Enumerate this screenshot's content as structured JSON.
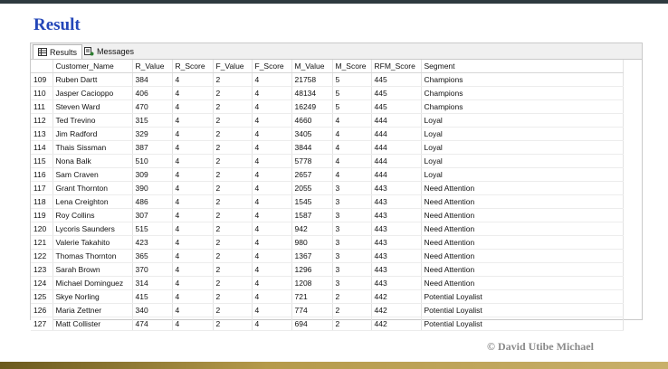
{
  "page": {
    "title": "Result",
    "copyright": "© David Utibe Michael"
  },
  "tabs": [
    {
      "label": "Results",
      "icon": "grid-icon",
      "active": true
    },
    {
      "label": "Messages",
      "icon": "messages-icon",
      "active": false
    }
  ],
  "table": {
    "columns": [
      "Customer_Name",
      "R_Value",
      "R_Score",
      "F_Value",
      "F_Score",
      "M_Value",
      "M_Score",
      "RFM_Score",
      "Segment"
    ],
    "rows": [
      {
        "num": "109",
        "cells": [
          "Ruben Dartt",
          "384",
          "4",
          "2",
          "4",
          "21758",
          "5",
          "445",
          "Champions"
        ]
      },
      {
        "num": "110",
        "cells": [
          "Jasper Cacioppo",
          "406",
          "4",
          "2",
          "4",
          "48134",
          "5",
          "445",
          "Champions"
        ]
      },
      {
        "num": "111",
        "cells": [
          "Steven Ward",
          "470",
          "4",
          "2",
          "4",
          "16249",
          "5",
          "445",
          "Champions"
        ]
      },
      {
        "num": "112",
        "cells": [
          "Ted Trevino",
          "315",
          "4",
          "2",
          "4",
          "4660",
          "4",
          "444",
          "Loyal"
        ]
      },
      {
        "num": "113",
        "cells": [
          "Jim Radford",
          "329",
          "4",
          "2",
          "4",
          "3405",
          "4",
          "444",
          "Loyal"
        ]
      },
      {
        "num": "114",
        "cells": [
          "Thais Sissman",
          "387",
          "4",
          "2",
          "4",
          "3844",
          "4",
          "444",
          "Loyal"
        ]
      },
      {
        "num": "115",
        "cells": [
          "Nona Balk",
          "510",
          "4",
          "2",
          "4",
          "5778",
          "4",
          "444",
          "Loyal"
        ]
      },
      {
        "num": "116",
        "cells": [
          "Sam Craven",
          "309",
          "4",
          "2",
          "4",
          "2657",
          "4",
          "444",
          "Loyal"
        ]
      },
      {
        "num": "117",
        "cells": [
          "Grant Thornton",
          "390",
          "4",
          "2",
          "4",
          "2055",
          "3",
          "443",
          "Need Attention"
        ]
      },
      {
        "num": "118",
        "cells": [
          "Lena Creighton",
          "486",
          "4",
          "2",
          "4",
          "1545",
          "3",
          "443",
          "Need Attention"
        ]
      },
      {
        "num": "119",
        "cells": [
          "Roy Collins",
          "307",
          "4",
          "2",
          "4",
          "1587",
          "3",
          "443",
          "Need Attention"
        ]
      },
      {
        "num": "120",
        "cells": [
          "Lycoris Saunders",
          "515",
          "4",
          "2",
          "4",
          "942",
          "3",
          "443",
          "Need Attention"
        ]
      },
      {
        "num": "121",
        "cells": [
          "Valerie Takahito",
          "423",
          "4",
          "2",
          "4",
          "980",
          "3",
          "443",
          "Need Attention"
        ]
      },
      {
        "num": "122",
        "cells": [
          "Thomas Thornton",
          "365",
          "4",
          "2",
          "4",
          "1367",
          "3",
          "443",
          "Need Attention"
        ]
      },
      {
        "num": "123",
        "cells": [
          "Sarah Brown",
          "370",
          "4",
          "2",
          "4",
          "1296",
          "3",
          "443",
          "Need Attention"
        ]
      },
      {
        "num": "124",
        "cells": [
          "Michael Dominguez",
          "314",
          "4",
          "2",
          "4",
          "1208",
          "3",
          "443",
          "Need Attention"
        ]
      },
      {
        "num": "125",
        "cells": [
          "Skye Norling",
          "415",
          "4",
          "2",
          "4",
          "721",
          "2",
          "442",
          "Potential Loyalist"
        ]
      },
      {
        "num": "126",
        "cells": [
          "Maria Zettner",
          "340",
          "4",
          "2",
          "4",
          "774",
          "2",
          "442",
          "Potential Loyalist"
        ]
      },
      {
        "num": "127",
        "cells": [
          "Matt Collister",
          "474",
          "4",
          "2",
          "4",
          "694",
          "2",
          "442",
          "Potential Loyalist"
        ]
      }
    ]
  }
}
